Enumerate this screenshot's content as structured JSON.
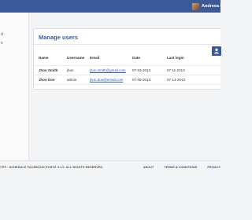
{
  "topbar": {
    "user_name": "Andreea R",
    "brand_color": "#3b5998"
  },
  "sidebar": {
    "items": [
      {
        "label": "d"
      },
      {
        "label": "s"
      }
    ]
  },
  "main": {
    "title": "Manage users",
    "add_button_icon": "add-user-icon",
    "table": {
      "columns": [
        "Name",
        "Username",
        "Email",
        "Date",
        "Last login"
      ],
      "rows": [
        {
          "name": "Jhon Smith",
          "username": "jhon",
          "email": "jhon.smith@gmail.com",
          "date": "07-03-2013",
          "last_login": "07-11-2013"
        },
        {
          "name": "Jhon Doe",
          "username": "admin",
          "email": "jhon.doe@email.com",
          "date": "07-09-2013",
          "last_login": "07-14-2013"
        }
      ]
    }
  },
  "footer": {
    "copyright": "©PP - SCHEDULE FACEBOOK POSTS V.1.0. ALL RIGHTS RESERVED.",
    "links": [
      "ABOUT",
      "TERMS & CONDITIONS",
      "PRIVACY"
    ]
  }
}
